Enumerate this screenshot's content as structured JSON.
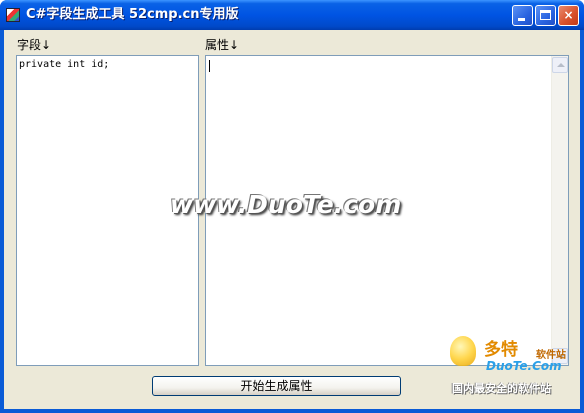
{
  "window": {
    "title": "C#字段生成工具 52cmp.cn专用版",
    "controls": {
      "minimize": "minimize",
      "maximize": "maximize",
      "close": "×"
    }
  },
  "fields": {
    "label": "字段↓",
    "value": "private int id;"
  },
  "properties": {
    "label": "属性↓",
    "value": ""
  },
  "generate_button": {
    "label": "开始生成属性"
  },
  "watermark": {
    "text": "www.DuoTe.com"
  },
  "logo": {
    "name_cn": "多特",
    "suffix": "软件站",
    "domain": "DuoTe.Com",
    "tagline": "国内最安全的软件站"
  },
  "colors": {
    "titlebar": "#0054e3",
    "client_bg": "#ece9d8",
    "textbox_border": "#7f9db9",
    "close_button": "#d9532e"
  }
}
